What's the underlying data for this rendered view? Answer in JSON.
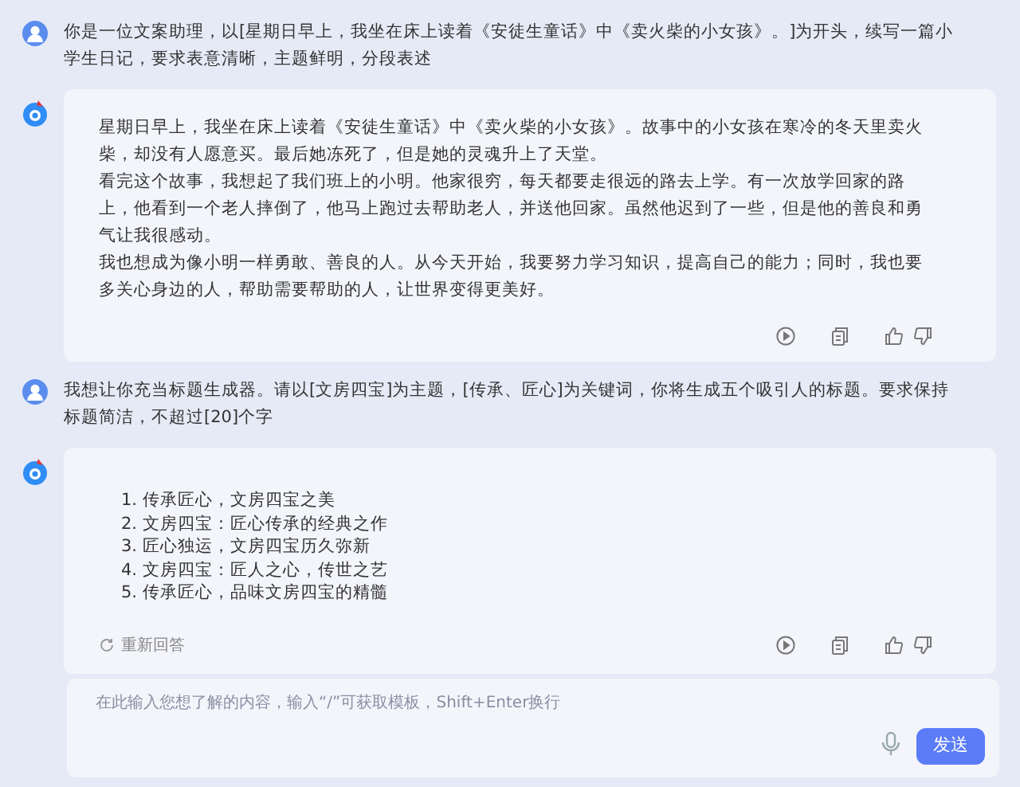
{
  "messages": [
    {
      "kind": "user",
      "text": "你是一位文案助理，以[星期日早上，我坐在床上读着《安徒生童话》中《卖火柴的小女孩》。]为开头，续写一篇小学生日记，要求表意清晰，主题鲜明，分段表述"
    },
    {
      "kind": "bot",
      "paragraphs": [
        "星期日早上，我坐在床上读着《安徒生童话》中《卖火柴的小女孩》。故事中的小女孩在寒冷的冬天里卖火柴，却没有人愿意买。最后她冻死了，但是她的灵魂升上了天堂。",
        "看完这个故事，我想起了我们班上的小明。他家很穷，每天都要走很远的路去上学。有一次放学回家的路上，他看到一个老人摔倒了，他马上跑过去帮助老人，并送他回家。虽然他迟到了一些，但是他的善良和勇气让我很感动。",
        "我也想成为像小明一样勇敢、善良的人。从今天开始，我要努力学习知识，提高自己的能力；同时，我也要多关心身边的人，帮助需要帮助的人，让世界变得更美好。"
      ]
    },
    {
      "kind": "user",
      "text": "我想让你充当标题生成器。请以[文房四宝]为主题，[传承、匠心]为关键词，你将生成五个吸引人的标题。要求保持标题简洁，不超过[20]个字"
    },
    {
      "kind": "bot",
      "list": [
        "1. 传承匠心，文房四宝之美",
        "2. 文房四宝：匠心传承的经典之作",
        "3. 匠心独运，文房四宝历久弥新",
        "4. 文房四宝：匠人之心，传世之艺",
        "5. 传承匠心，品味文房四宝的精髓"
      ],
      "regenerate": "重新回答"
    }
  ],
  "composer": {
    "placeholder": "在此输入您想了解的内容，输入“/”可获取模板，Shift+Enter换行",
    "send": "发送"
  }
}
